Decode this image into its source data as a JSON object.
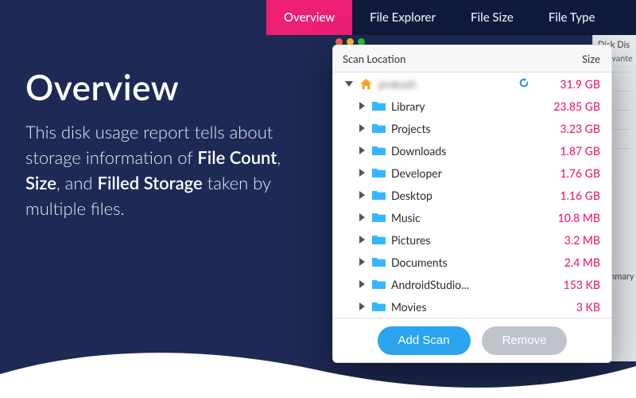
{
  "tabs": [
    "Overview",
    "File Explorer",
    "File Size",
    "File Type"
  ],
  "active_tab": 0,
  "hero": {
    "title": "Overview",
    "body_pre": "This disk usage report tells about storage information of ",
    "b1": "File Count",
    "sep1": ", ",
    "b2": "Size",
    "sep2": ", and ",
    "b3": "Filled Storage",
    "body_post": " taken by multiple files."
  },
  "panel": {
    "col_location": "Scan Location",
    "col_size": "Size",
    "root": {
      "name": "prakash",
      "size": "31.9 GB",
      "blurred": true
    },
    "items": [
      {
        "name": "Library",
        "size": "23.85 GB"
      },
      {
        "name": "Projects",
        "size": "3.23 GB"
      },
      {
        "name": "Downloads",
        "size": "1.87 GB"
      },
      {
        "name": "Developer",
        "size": "1.76 GB"
      },
      {
        "name": "Desktop",
        "size": "1.16 GB"
      },
      {
        "name": "Music",
        "size": "10.8 MB"
      },
      {
        "name": "Pictures",
        "size": "3.2 MB"
      },
      {
        "name": "Documents",
        "size": "2.4 MB"
      },
      {
        "name": "AndroidStudio...",
        "size": "153 KB"
      },
      {
        "name": "Movies",
        "size": "3 KB"
      }
    ],
    "add_scan": "Add Scan",
    "remove": "Remove"
  },
  "side": {
    "header": "Disk Dis",
    "row1": "Unwante",
    "summary": "Summary"
  },
  "colors": {
    "accent": "#ec1f74",
    "primary": "#2aa4ef",
    "bg": "#1e2a55"
  }
}
